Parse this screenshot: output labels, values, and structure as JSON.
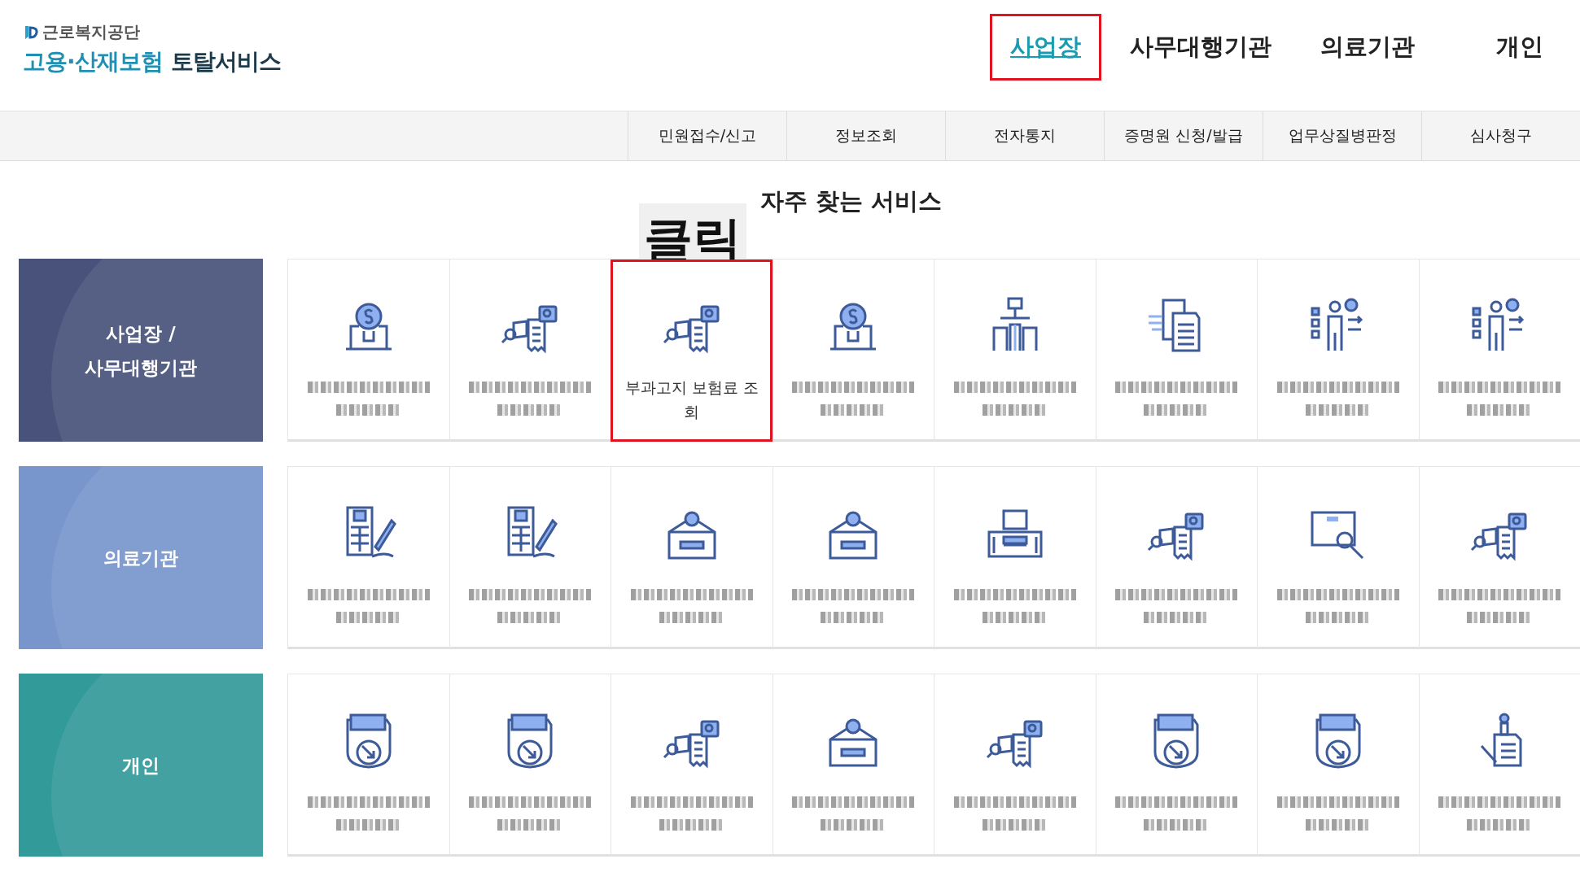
{
  "logo": {
    "org": "근로복지공단",
    "service_main": "고용·산재보험",
    "service_sub": "토탈서비스"
  },
  "nav": [
    {
      "label": "사업장",
      "selected": true,
      "highlighted": true
    },
    {
      "label": "사무대행기관",
      "selected": false,
      "highlighted": false
    },
    {
      "label": "의료기관",
      "selected": false,
      "highlighted": false
    },
    {
      "label": "개인",
      "selected": false,
      "highlighted": false
    }
  ],
  "subnav": [
    "민원접수/신고",
    "정보조회",
    "전자통지",
    "증명원 신청/발급",
    "업무상질병판정",
    "심사청구"
  ],
  "section_title": "자주 찾는 서비스",
  "annotation": "클릭",
  "categories": [
    {
      "title": "사업장 /\n사무대행기관",
      "color": "#48527a",
      "services": [
        {
          "kind": "obscured",
          "highlighted": false
        },
        {
          "kind": "obscured",
          "highlighted": false
        },
        {
          "kind": "text",
          "label": "부과고지 보험료 조회",
          "highlighted": true
        },
        {
          "kind": "obscured",
          "highlighted": false
        },
        {
          "kind": "obscured",
          "highlighted": false
        },
        {
          "kind": "obscured",
          "highlighted": false
        },
        {
          "kind": "obscured",
          "highlighted": false
        },
        {
          "kind": "obscured",
          "highlighted": false
        }
      ]
    },
    {
      "title": "의료기관",
      "color": "#7896cc",
      "services": [
        {
          "kind": "obscured",
          "highlighted": false
        },
        {
          "kind": "obscured",
          "highlighted": false
        },
        {
          "kind": "obscured",
          "highlighted": false
        },
        {
          "kind": "obscured",
          "highlighted": false
        },
        {
          "kind": "obscured",
          "highlighted": false
        },
        {
          "kind": "obscured",
          "highlighted": false
        },
        {
          "kind": "obscured",
          "highlighted": false
        },
        {
          "kind": "obscured",
          "highlighted": false
        }
      ]
    },
    {
      "title": "개인",
      "color": "#339a9a",
      "services": [
        {
          "kind": "obscured",
          "highlighted": false
        },
        {
          "kind": "obscured",
          "highlighted": false
        },
        {
          "kind": "obscured",
          "highlighted": false
        },
        {
          "kind": "obscured",
          "highlighted": false
        },
        {
          "kind": "obscured",
          "highlighted": false
        },
        {
          "kind": "obscured",
          "highlighted": false
        },
        {
          "kind": "obscured",
          "highlighted": false
        },
        {
          "kind": "obscured",
          "highlighted": false
        }
      ]
    }
  ]
}
